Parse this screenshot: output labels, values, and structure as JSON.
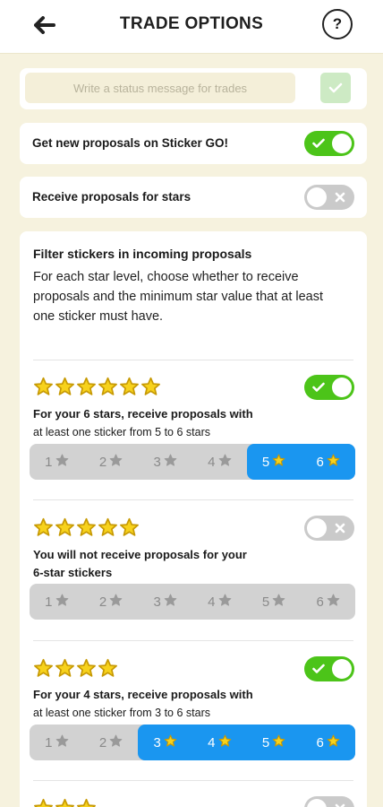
{
  "header": {
    "title": "TRADE OPTIONS",
    "back_icon": "arrow-left-icon",
    "help_label": "?"
  },
  "status": {
    "placeholder": "Write a status message for trades",
    "submit_icon": "check-icon"
  },
  "settings": [
    {
      "label": "Get new proposals on Sticker GO!",
      "enabled": true
    },
    {
      "label": "Receive proposals for stars",
      "enabled": false
    }
  ],
  "filter": {
    "title": "Filter stickers in incoming proposals",
    "description": "For each star level, choose whether to receive proposals and the minimum star value that at least one sticker must have.",
    "levels": [
      {
        "stars": 6,
        "enabled": true,
        "line1": "For your 6 stars, receive proposals with",
        "line2": "at least one sticker from 5 to 6 stars",
        "options": [
          "1",
          "2",
          "3",
          "4",
          "5",
          "6"
        ],
        "active_from": 5
      },
      {
        "stars": 5,
        "enabled": false,
        "line1": "You will not receive proposals for your",
        "line2": "6-star stickers",
        "options": [
          "1",
          "2",
          "3",
          "4",
          "5",
          "6"
        ],
        "active_from": null
      },
      {
        "stars": 4,
        "enabled": true,
        "line1": "For your 4 stars, receive proposals with",
        "line2": "at least one sticker from 3 to 6 stars",
        "options": [
          "1",
          "2",
          "3",
          "4",
          "5",
          "6"
        ],
        "active_from": 3
      },
      {
        "stars": 3,
        "enabled": false,
        "line1": "",
        "line2": "",
        "options": [],
        "active_from": null
      }
    ]
  },
  "colors": {
    "accent_green": "#4cc419",
    "accent_blue": "#1a96f0",
    "star_yellow": "#f7d21c",
    "background": "#f6f2de"
  }
}
